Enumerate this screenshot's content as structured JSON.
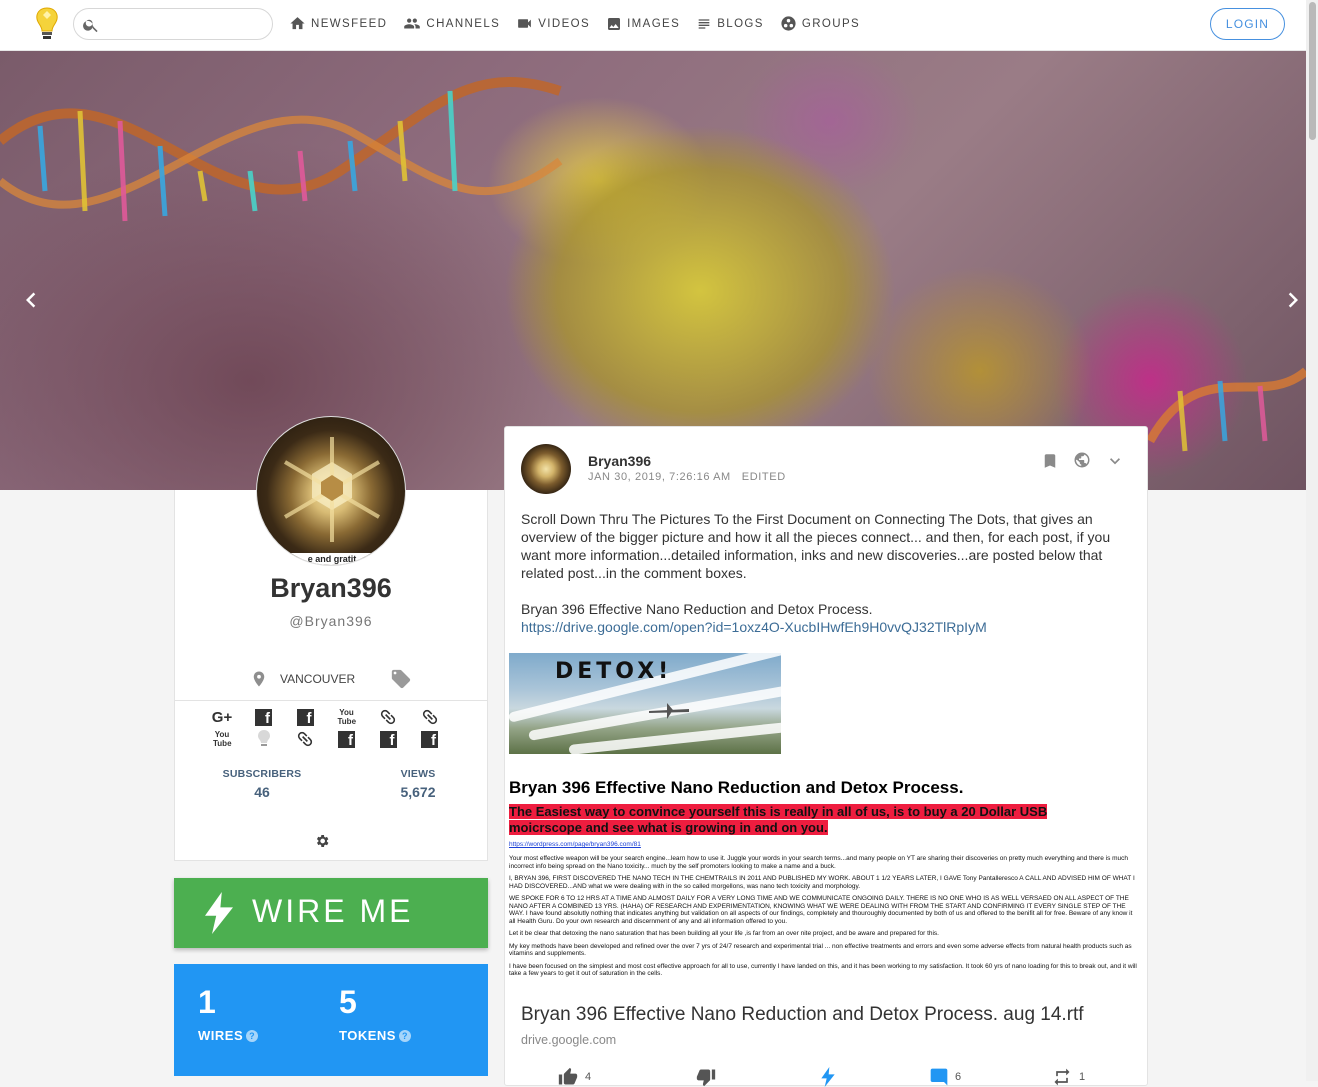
{
  "search": {
    "placeholder": ""
  },
  "nav": [
    {
      "label": "NEWSFEED",
      "icon": "home-icon"
    },
    {
      "label": "CHANNELS",
      "icon": "people-icon"
    },
    {
      "label": "VIDEOS",
      "icon": "videocam-icon"
    },
    {
      "label": "IMAGES",
      "icon": "image-icon"
    },
    {
      "label": "BLOGS",
      "icon": "subject-icon"
    },
    {
      "label": "GROUPS",
      "icon": "group-work-icon"
    }
  ],
  "login_label": "LOGIN",
  "profile": {
    "avatar_caption": "e and gratit",
    "name": "Bryan396",
    "handle": "@Bryan396",
    "location": "VANCOUVER",
    "socials_row1": [
      "G+",
      "f",
      "f",
      "You Tube",
      "link",
      "link"
    ],
    "socials_row2": [
      "You Tube",
      "minds",
      "link",
      "f",
      "f",
      "f"
    ],
    "subscribers_label": "SUBSCRIBERS",
    "subscribers": "46",
    "views_label": "VIEWS",
    "views": "5,672"
  },
  "wire": {
    "button_label": "WIRE ME",
    "wires_count": "1",
    "wires_label": "WIRES",
    "tokens_count": "5",
    "tokens_label": "TOKENS",
    "help_mark": "?"
  },
  "post": {
    "author": "Bryan396",
    "date": "JAN 30, 2019, 7:26:16 AM",
    "edited": "EDITED",
    "body_p1": "Scroll Down Thru The Pictures To the First Document on Connecting The Dots, that gives an overview of the bigger picture and how it all the pieces connect... and then, for each post, if you want more information...detailed information, inks and new discoveries...are posted below that related post...in the comment boxes.",
    "body_p2": "Bryan 396 Effective Nano Reduction and Detox Process.",
    "body_link": "https://drive.google.com/open?id=1oxz4O-XucbIHwfEh9H0vvQJ32TlRpIyM",
    "image_word": "DETOX!",
    "doc_heading": "Bryan 396 Effective Nano Reduction and Detox Process.",
    "doc_highlight": "The Easiest way to convince yourself this is really in all of us, is to buy a 20 Dollar USB moicrscope and see what is growing in and on you.",
    "doc_link": "https://wordpress.com/page/bryan396.com/81",
    "doc_p1": "Your most effective weapon will be your search engine...learn how to use it. Juggle your words in your search terms...and many people on YT are sharing their discoveries on pretty much everything and there is much incorrect info being spread on the Nano toxicity... much by the self promoters looking to make a name and a buck.",
    "doc_p2": "I, BRYAN 396, FIRST DISCOVERED THE NANO TECH IN THE CHEMTRAILS IN 2011 AND PUBLISHED MY WORK. ABOUT 1 1/2 YEARS LATER, I GAVE Tony Pantalleresco A CALL AND ADVISED HIM OF WHAT I HAD DISCOVERED...AND what we were dealing with in the so called morgellons, was nano tech toxicity and morphology.",
    "doc_p3": "WE SPOKE FOR 6 TO 12 HRS AT A TIME AND ALMOST DAILY FOR A VERY LONG TIME AND WE COMMUNICATE ONGOING DAILY. THERE IS NO ONE WHO IS AS WELL VERSAED ON ALL ASPECT OF THE NANO AFTER A COMBINED 13 YRS. (HAHA) OF RESEARCH AND EXPERIMENTATION, KNOWING WHAT WE WERE DEALING WITH FROM THE START AND CONFIRMING IT EVERY SINGLE STEP OF THE WAY. I have found absolutly nothing that indicates anything but validation on all aspects of our findings, completely and thouroughly documented by both of us and offered to the benifit all for free. Beware of any know it all Health Guru. Do your own research and discernment of any and all information offered to you.",
    "doc_p4": "Let it be clear that detoxing the nano saturation that has been building all your life ,is far from an over nite project, and be aware and prepared for this.",
    "doc_p5": "My key methods have been developed and refined over the over 7 yrs of 24/7 research and experimental trial ... non effective treatments and errors and even some adverse effects from natural health products such as vitamins and supplements.",
    "doc_p6": "I have been focused on the simplest and most cost effective approach for all to use, currently I have landed on this, and it has been working to my satisfaction. It took 60 yrs of nano loading for this to break out, and it will take a few years to get it out of saturation in the cells.",
    "title": "Bryan 396 Effective Nano Reduction and Detox Process. aug 14.rtf",
    "domain": "drive.google.com",
    "votes_up": "4",
    "comments": "6",
    "reminds": "1"
  },
  "colors": {
    "accent": "#4690df",
    "wire_green": "#4caf50",
    "wire_blue": "#2196f3",
    "highlight_red": "#ee1d3f"
  }
}
